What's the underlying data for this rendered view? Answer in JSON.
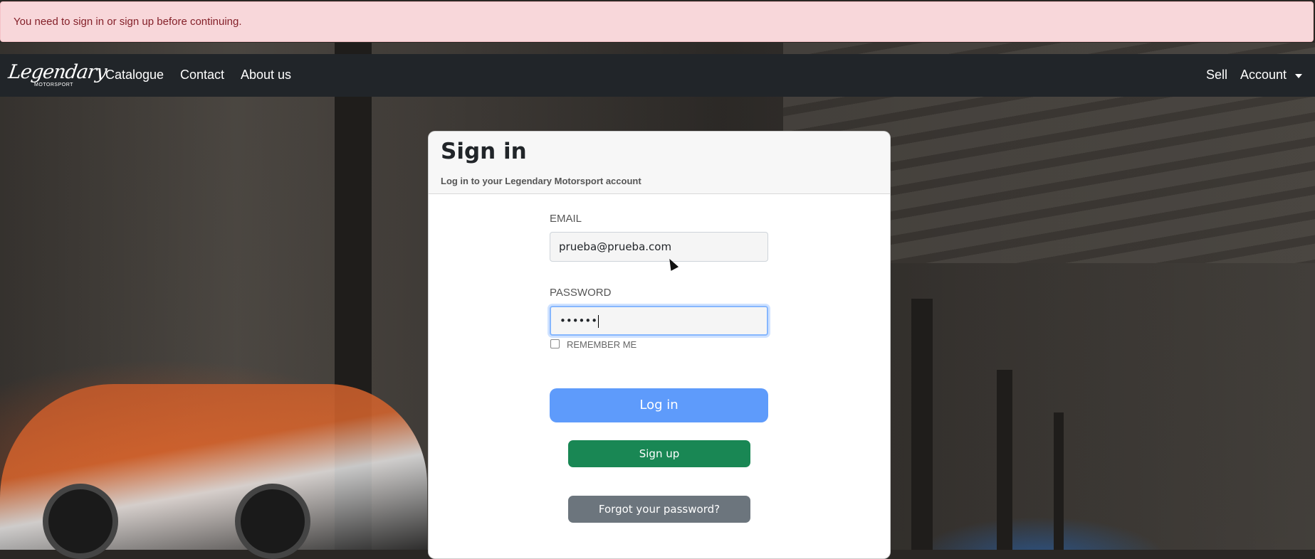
{
  "alert": {
    "message": "You need to sign in or sign up before continuing."
  },
  "navbar": {
    "brand": {
      "name": "Legendary",
      "tagline": "MOTORSPORT"
    },
    "left_links": [
      "Catalogue",
      "Contact",
      "About us"
    ],
    "right_links": {
      "sell": "Sell",
      "account": "Account"
    }
  },
  "signin": {
    "title": "Sign in",
    "subtitle": "Log in to your Legendary Motorsport account",
    "email_label": "EMAIL",
    "email_value": "prueba@prueba.com",
    "password_label": "PASSWORD",
    "password_value": "••••••",
    "remember_label": "REMEMBER ME",
    "remember_checked": false,
    "login_button": "Log in",
    "signup_button": "Sign up",
    "forgot_button": "Forgot your password?"
  },
  "colors": {
    "alert_bg": "#f8d7da",
    "alert_text": "#842029",
    "navbar_bg": "#212529",
    "login_button": "#5e9bfb",
    "signup_button": "#198754",
    "forgot_button": "#6c757d"
  }
}
